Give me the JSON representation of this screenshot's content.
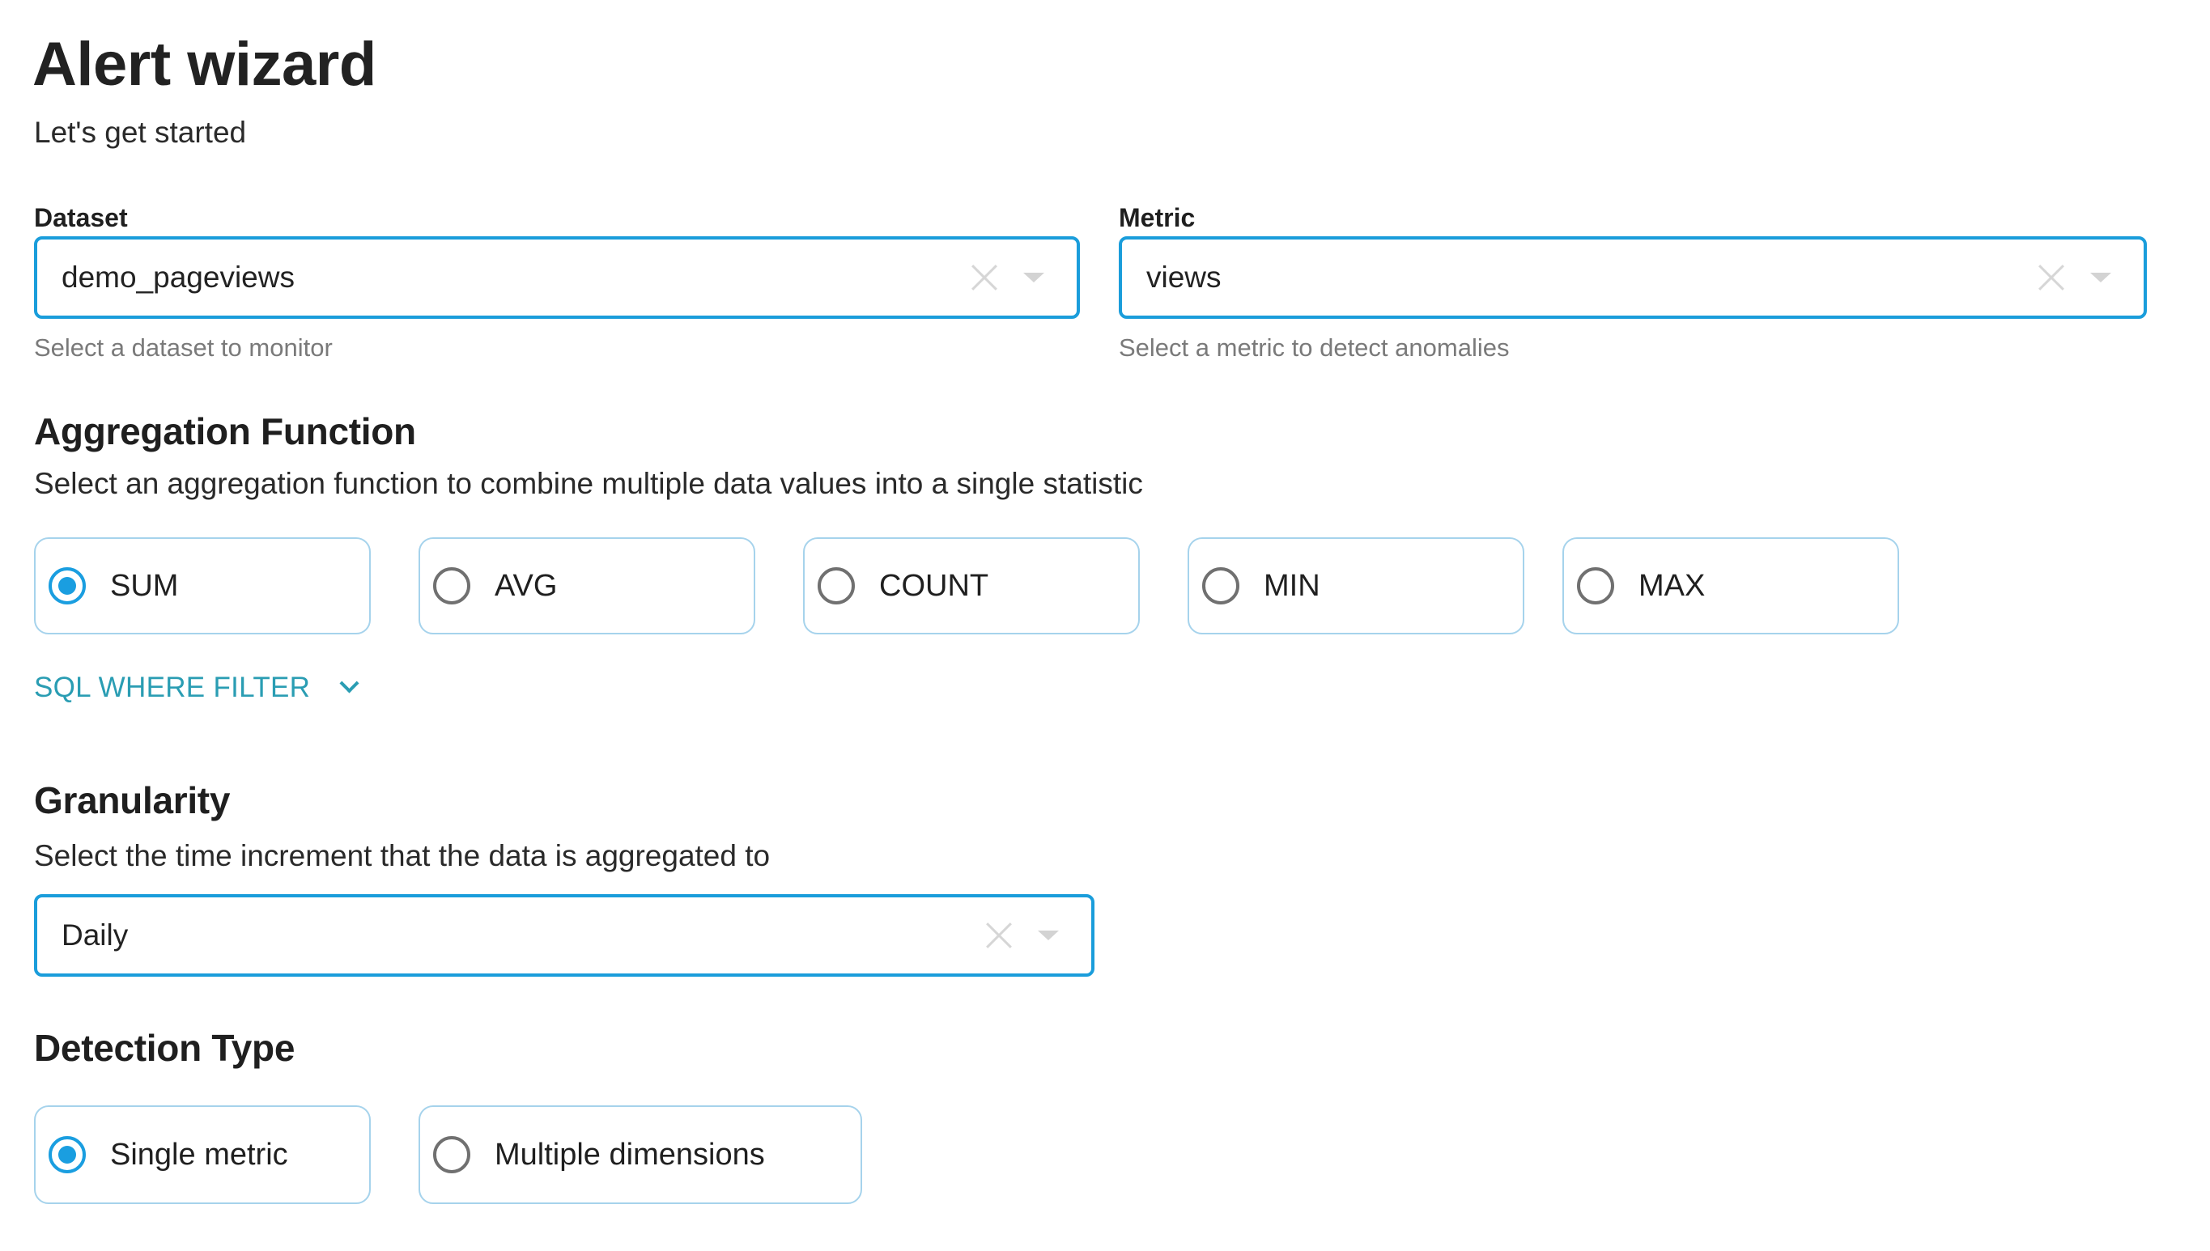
{
  "header": {
    "title": "Alert wizard",
    "subtitle": "Let's get started"
  },
  "dataset": {
    "label": "Dataset",
    "value": "demo_pageviews",
    "helper": "Select a dataset to monitor",
    "clear_icon": "close-icon",
    "dropdown_icon": "caret-down-icon"
  },
  "metric": {
    "label": "Metric",
    "value": "views",
    "helper": "Select a metric to detect anomalies",
    "clear_icon": "close-icon",
    "dropdown_icon": "caret-down-icon"
  },
  "aggregation": {
    "heading": "Aggregation Function",
    "description": "Select an aggregation function to combine multiple data values into a single statistic",
    "options": [
      {
        "label": "SUM",
        "selected": true
      },
      {
        "label": "AVG",
        "selected": false
      },
      {
        "label": "COUNT",
        "selected": false
      },
      {
        "label": "MIN",
        "selected": false
      },
      {
        "label": "MAX",
        "selected": false
      }
    ]
  },
  "sql_filter": {
    "label": "SQL WHERE FILTER",
    "icon": "chevron-down-icon",
    "expanded": false
  },
  "granularity": {
    "heading": "Granularity",
    "description": "Select the time increment that the data is aggregated to",
    "value": "Daily",
    "clear_icon": "close-icon",
    "dropdown_icon": "caret-down-icon"
  },
  "detection_type": {
    "heading": "Detection Type",
    "options": [
      {
        "label": "Single metric",
        "selected": true
      },
      {
        "label": "Multiple dimensions",
        "selected": false
      }
    ]
  },
  "colors": {
    "accent": "#1a9ddb",
    "card_border": "#a6d3ec",
    "link": "#2a9db3",
    "helper_text": "#7a7a7a",
    "text": "#222222"
  }
}
